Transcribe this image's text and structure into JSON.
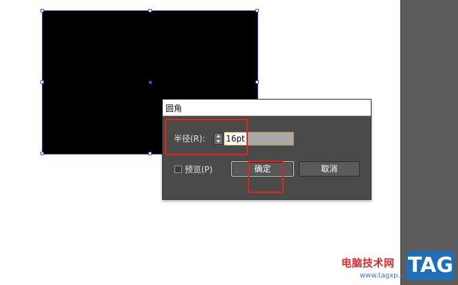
{
  "dialog": {
    "title": "圆角",
    "radius_label": "半径(R):",
    "radius_value": "16pt",
    "preview_label": "预览(P)",
    "ok_label": "确定",
    "cancel_label": "取消"
  },
  "watermark": {
    "text": "电脑技术网",
    "url": "www.tagxp.com",
    "logo": "TAG"
  },
  "colors": {
    "highlight": "#e6231b",
    "selection": "#3a55c8",
    "dialog_bg": "#4a4a4a",
    "panel_bg": "#5c5c5c"
  }
}
